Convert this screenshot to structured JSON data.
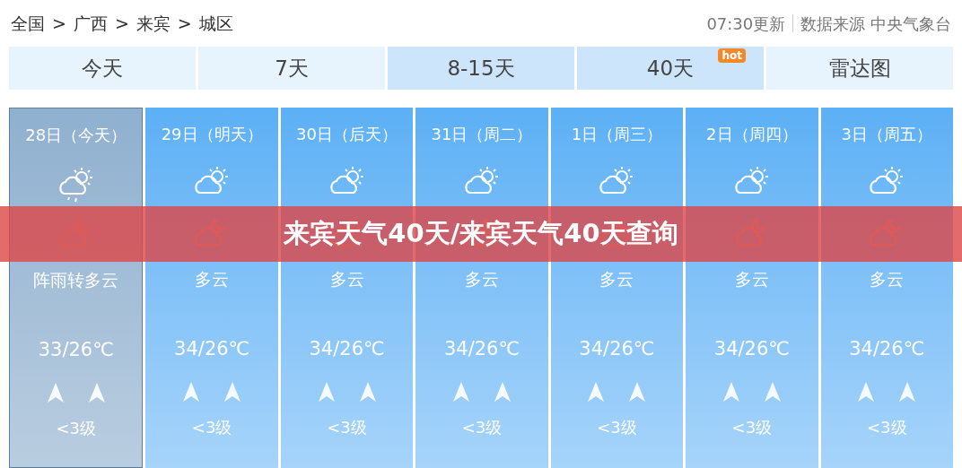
{
  "breadcrumb": [
    "全国",
    ">",
    "广西",
    ">",
    "来宾",
    ">",
    "城区"
  ],
  "update_time": "07:30更新",
  "source": "数据来源 中央气象台",
  "tabs": [
    {
      "label": "今天",
      "shaded": false
    },
    {
      "label": "7天",
      "shaded": false
    },
    {
      "label": "8-15天",
      "shaded": true
    },
    {
      "label": "40天",
      "shaded": true,
      "badge": "hot"
    },
    {
      "label": "雷达图",
      "shaded": false
    }
  ],
  "days": [
    {
      "date": "28日（今天）",
      "selected": true,
      "kind": "shower",
      "weather": "阵雨转多云",
      "temp": "33/26℃",
      "wind": "<3级"
    },
    {
      "date": "29日（明天）",
      "selected": false,
      "kind": "partly_cloudy",
      "weather": "多云",
      "temp": "34/26℃",
      "wind": "<3级"
    },
    {
      "date": "30日（后天）",
      "selected": false,
      "kind": "partly_cloudy",
      "weather": "多云",
      "temp": "34/26℃",
      "wind": "<3级"
    },
    {
      "date": "31日（周二）",
      "selected": false,
      "kind": "partly_cloudy",
      "weather": "多云",
      "temp": "34/26℃",
      "wind": "<3级"
    },
    {
      "date": "1日（周三）",
      "selected": false,
      "kind": "partly_cloudy",
      "weather": "多云",
      "temp": "34/26℃",
      "wind": "<3级"
    },
    {
      "date": "2日（周四）",
      "selected": false,
      "kind": "partly_cloudy",
      "weather": "多云",
      "temp": "34/26℃",
      "wind": "<3级"
    },
    {
      "date": "3日（周五）",
      "selected": false,
      "kind": "partly_cloudy",
      "weather": "多云",
      "temp": "34/26℃",
      "wind": "<3级"
    }
  ],
  "banner": "来宾天气40天/来宾天气40天查询"
}
